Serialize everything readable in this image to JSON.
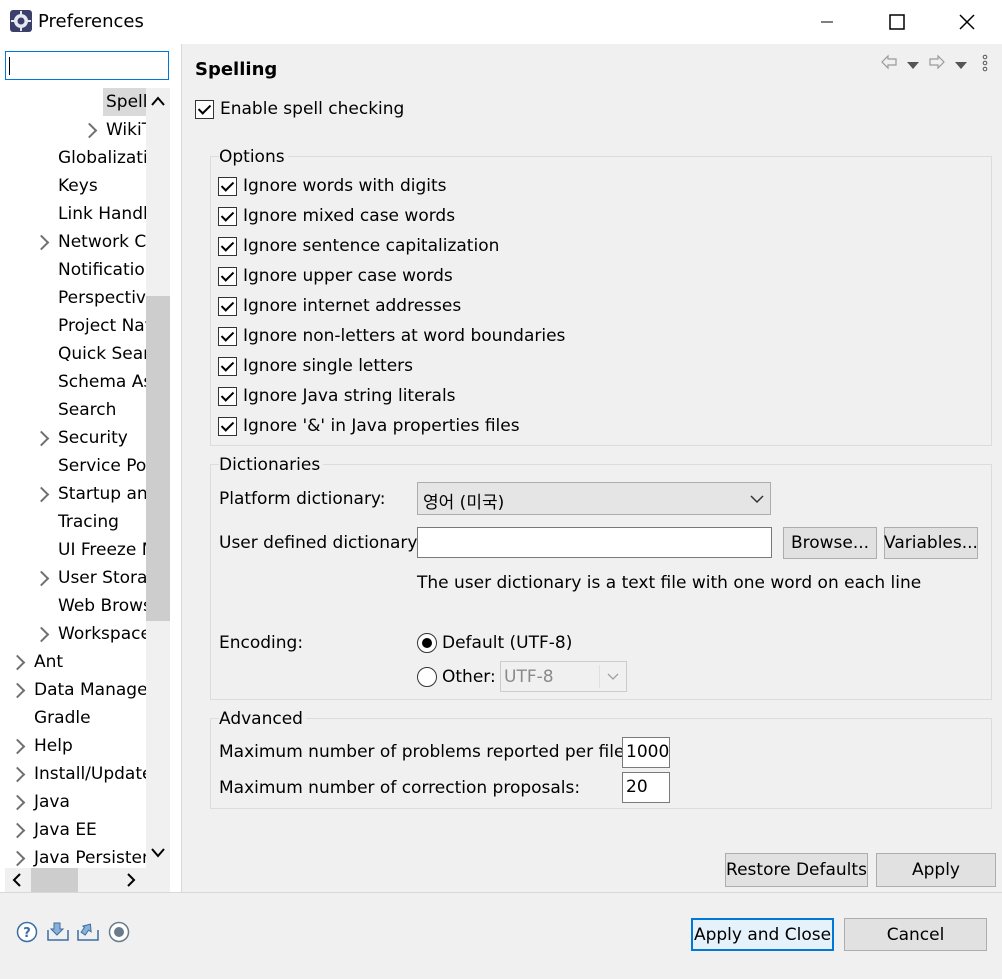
{
  "window": {
    "title": "Preferences"
  },
  "filter": {
    "value": ""
  },
  "tree": {
    "items": [
      {
        "label": "Spell",
        "indent": 2,
        "chevron": false,
        "selected": true
      },
      {
        "label": "WikiT",
        "indent": 2,
        "chevron": true
      },
      {
        "label": "Globalizatio",
        "indent": 1,
        "chevron": false
      },
      {
        "label": "Keys",
        "indent": 1,
        "chevron": false
      },
      {
        "label": "Link Handle",
        "indent": 1,
        "chevron": false
      },
      {
        "label": "Network C",
        "indent": 1,
        "chevron": true
      },
      {
        "label": "Notification",
        "indent": 1,
        "chevron": false
      },
      {
        "label": "Perspective",
        "indent": 1,
        "chevron": false
      },
      {
        "label": "Project Nat",
        "indent": 1,
        "chevron": false
      },
      {
        "label": "Quick Sear",
        "indent": 1,
        "chevron": false
      },
      {
        "label": "Schema As",
        "indent": 1,
        "chevron": false
      },
      {
        "label": "Search",
        "indent": 1,
        "chevron": false
      },
      {
        "label": "Security",
        "indent": 1,
        "chevron": true
      },
      {
        "label": "Service Pol",
        "indent": 1,
        "chevron": false
      },
      {
        "label": "Startup and",
        "indent": 1,
        "chevron": true
      },
      {
        "label": "Tracing",
        "indent": 1,
        "chevron": false
      },
      {
        "label": "UI Freeze M",
        "indent": 1,
        "chevron": false
      },
      {
        "label": "User Storag",
        "indent": 1,
        "chevron": true
      },
      {
        "label": "Web Brows",
        "indent": 1,
        "chevron": false
      },
      {
        "label": "Workspace",
        "indent": 1,
        "chevron": true
      },
      {
        "label": "Ant",
        "indent": 0,
        "chevron": true
      },
      {
        "label": "Data Managen",
        "indent": 0,
        "chevron": true
      },
      {
        "label": "Gradle",
        "indent": 0,
        "chevron": false
      },
      {
        "label": "Help",
        "indent": 0,
        "chevron": true
      },
      {
        "label": "Install/Update",
        "indent": 0,
        "chevron": true
      },
      {
        "label": "Java",
        "indent": 0,
        "chevron": true
      },
      {
        "label": "Java EE",
        "indent": 0,
        "chevron": true
      },
      {
        "label": "Java Persisten",
        "indent": 0,
        "chevron": true
      }
    ]
  },
  "page": {
    "title": "Spelling",
    "enable": "Enable spell checking",
    "options": {
      "legend": "Options",
      "items": [
        "Ignore words with digits",
        "Ignore mixed case words",
        "Ignore sentence capitalization",
        "Ignore upper case words",
        "Ignore internet addresses",
        "Ignore non-letters at word boundaries",
        "Ignore single letters",
        "Ignore Java string literals",
        "Ignore '&' in Java properties files"
      ]
    },
    "dictionaries": {
      "legend": "Dictionaries",
      "platform_label": "Platform dictionary:",
      "platform_value": "영어 (미국)",
      "user_label": "User defined dictionary:",
      "user_value": "",
      "browse": "Browse...",
      "variables": "Variables...",
      "note": "The user dictionary is a text file with one word on each line",
      "encoding_label": "Encoding:",
      "default_option": "Default (UTF-8)",
      "other_option": "Other:",
      "other_value": "UTF-8"
    },
    "advanced": {
      "legend": "Advanced",
      "max_problems_label": "Maximum number of problems reported per file:",
      "max_problems_value": "1000",
      "max_proposals_label": "Maximum number of correction proposals:",
      "max_proposals_value": "20"
    },
    "restore_defaults": "Restore Defaults",
    "apply": "Apply"
  },
  "footer": {
    "apply_close": "Apply and Close",
    "cancel": "Cancel"
  },
  "colors": {
    "accent": "#0078d7",
    "panel_bg": "#f0f0f0"
  }
}
